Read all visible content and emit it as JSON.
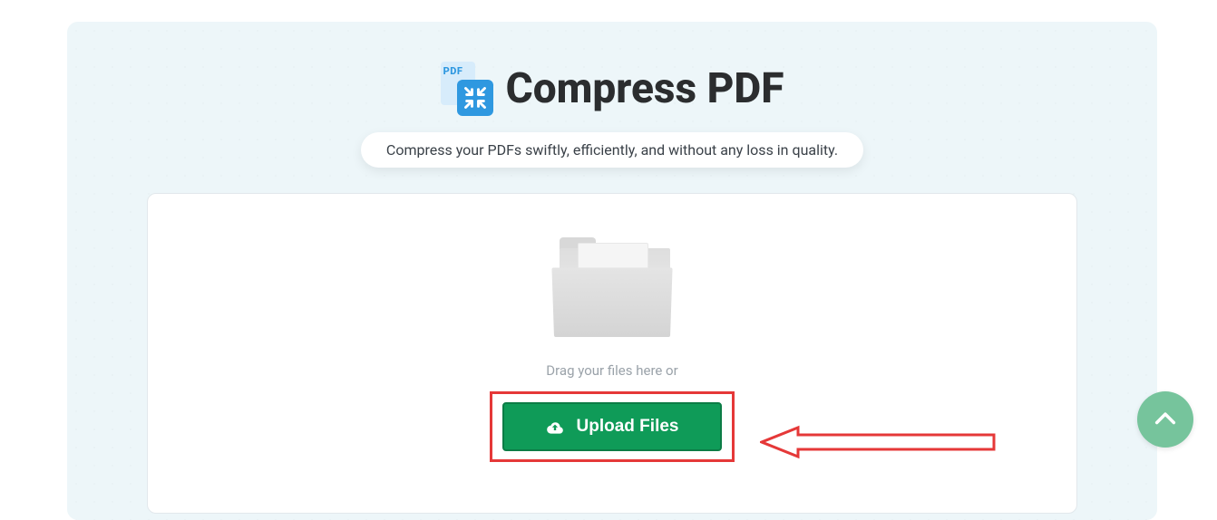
{
  "header": {
    "title": "Compress PDF",
    "icon_pdf_label": "PDF",
    "subtitle": "Compress your PDFs swiftly, efficiently, and without any loss in quality."
  },
  "upload": {
    "drag_text": "Drag your files here or",
    "button_label": "Upload Files"
  },
  "colors": {
    "accent_green": "#0f9b58",
    "accent_blue": "#2f98e0",
    "annotation_red": "#e53838",
    "scroll_btn": "#76c49c"
  }
}
